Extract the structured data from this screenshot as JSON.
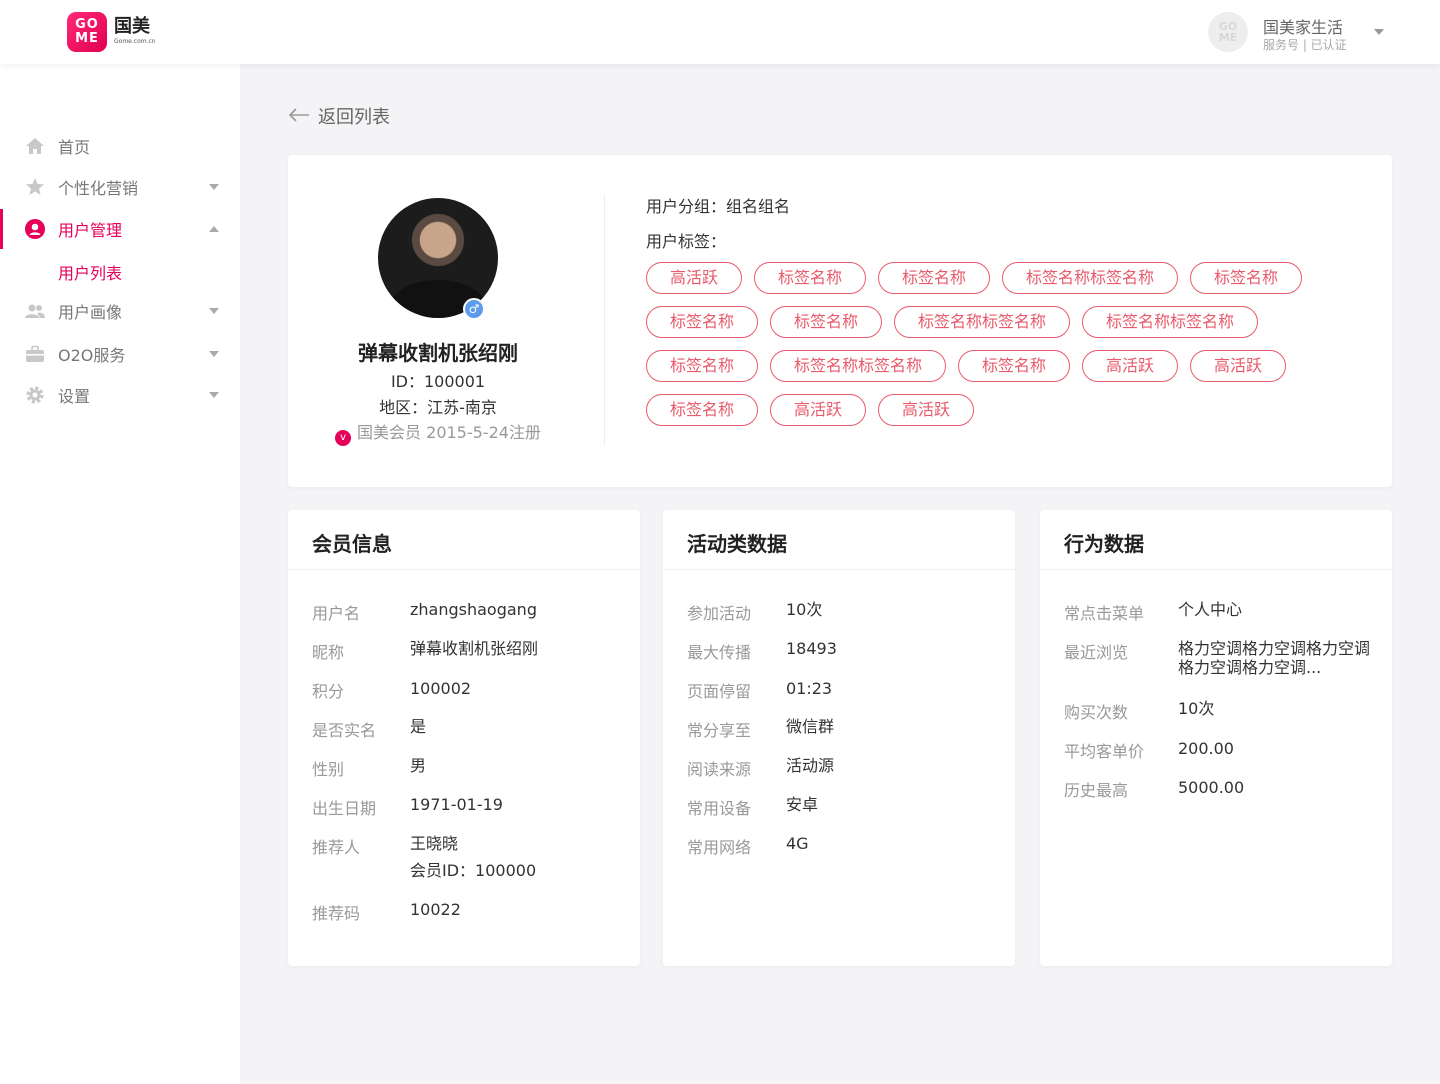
{
  "header": {
    "logo_mark_top": "GO",
    "logo_mark_bottom": "ME",
    "logo_cn": "国美",
    "logo_en": "Gome.com.cn",
    "account_name": "国美家生活",
    "account_meta": "服务号 | 已认证",
    "avatar_top": "GO",
    "avatar_bottom": "ME"
  },
  "sidebar": {
    "items": [
      {
        "label": "首页",
        "icon": "home-icon"
      },
      {
        "label": "个性化营销",
        "icon": "star-icon"
      },
      {
        "label": "用户管理",
        "icon": "user-circle-icon"
      },
      {
        "label": "用户画像",
        "icon": "users-icon"
      },
      {
        "label": "O2O服务",
        "icon": "briefcase-icon"
      },
      {
        "label": "设置",
        "icon": "gear-icon"
      }
    ],
    "sub_item": "用户列表",
    "active": "用户管理",
    "accent_color": "#e60059"
  },
  "back_label": "返回列表",
  "profile": {
    "name": "弹幕收割机张绍刚",
    "id_line": "ID：100001",
    "region_line": "地区：江苏-南京",
    "member_line": "国美会员 2015-5-24注册",
    "gender_symbol": "♂",
    "group_line": "用户分组：组名组名",
    "tags_title": "用户标签：",
    "tags": [
      "高活跃",
      "标签名称",
      "标签名称",
      "标签名称标签名称",
      "标签名称",
      "标签名称",
      "标签名称",
      "标签名称标签名称",
      "标签名称标签名称",
      "标签名称",
      "标签名称标签名称",
      "标签名称",
      "高活跃",
      "高活跃",
      "标签名称",
      "高活跃",
      "高活跃"
    ],
    "tag_color": "#e85a6b"
  },
  "member_info": {
    "title": "会员信息",
    "rows": [
      {
        "k": "用户名",
        "v": "zhangshaogang"
      },
      {
        "k": "昵称",
        "v": "弹幕收割机张绍刚"
      },
      {
        "k": "积分",
        "v": "100002"
      },
      {
        "k": "是否实名",
        "v": "是"
      },
      {
        "k": "性别",
        "v": "男"
      },
      {
        "k": "出生日期",
        "v": "1971-01-19"
      },
      {
        "k": "推荐人",
        "v": "王晓晓",
        "v2": "会员ID：100000"
      },
      {
        "k": "推荐码",
        "v": "10022"
      }
    ]
  },
  "activity": {
    "title": "活动类数据",
    "rows": [
      {
        "k": "参加活动",
        "v": "10次"
      },
      {
        "k": "最大传播",
        "v": "18493"
      },
      {
        "k": "页面停留",
        "v": "01:23"
      },
      {
        "k": "常分享至",
        "v": "微信群"
      },
      {
        "k": "阅读来源",
        "v": "活动源"
      },
      {
        "k": "常用设备",
        "v": "安卓"
      },
      {
        "k": "常用网络",
        "v": "4G"
      }
    ]
  },
  "behavior": {
    "title": "行为数据",
    "rows": [
      {
        "k": "常点击菜单",
        "v": "个人中心"
      },
      {
        "k": "最近浏览",
        "v": "格力空调格力空调格力空调",
        "v2": "格力空调格力空调..."
      },
      {
        "k": "购买次数",
        "v": "10次"
      },
      {
        "k": "平均客单价",
        "v": "200.00"
      },
      {
        "k": "历史最高",
        "v": "5000.00"
      }
    ]
  }
}
